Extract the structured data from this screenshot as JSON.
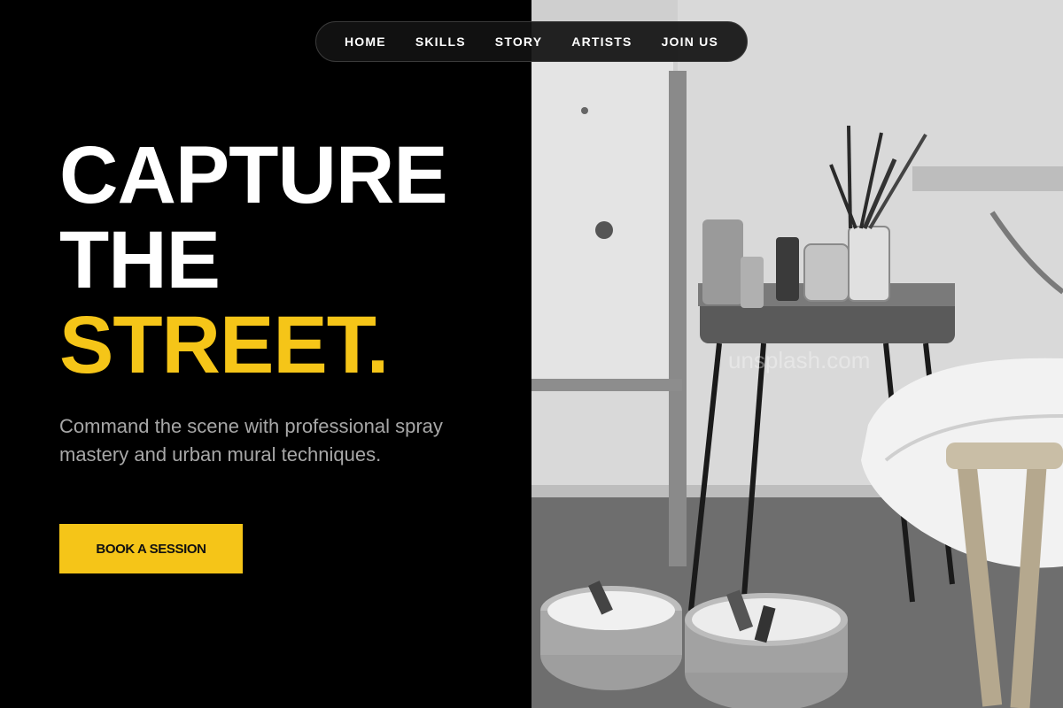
{
  "nav": {
    "items": [
      "HOME",
      "SKILLS",
      "STORY",
      "ARTISTS",
      "JOIN US"
    ]
  },
  "hero": {
    "title_line1": "CAPTURE",
    "title_line2": "THE",
    "title_line3": "STREET.",
    "subtitle": "Command the scene with professional spray mastery and urban mural techniques.",
    "cta_label": "BOOK A SESSION"
  },
  "photo": {
    "watermark": "unsplash.com"
  },
  "colors": {
    "accent": "#f5c518",
    "background": "#000000",
    "text": "#ffffff",
    "muted": "#a7a7a7"
  }
}
